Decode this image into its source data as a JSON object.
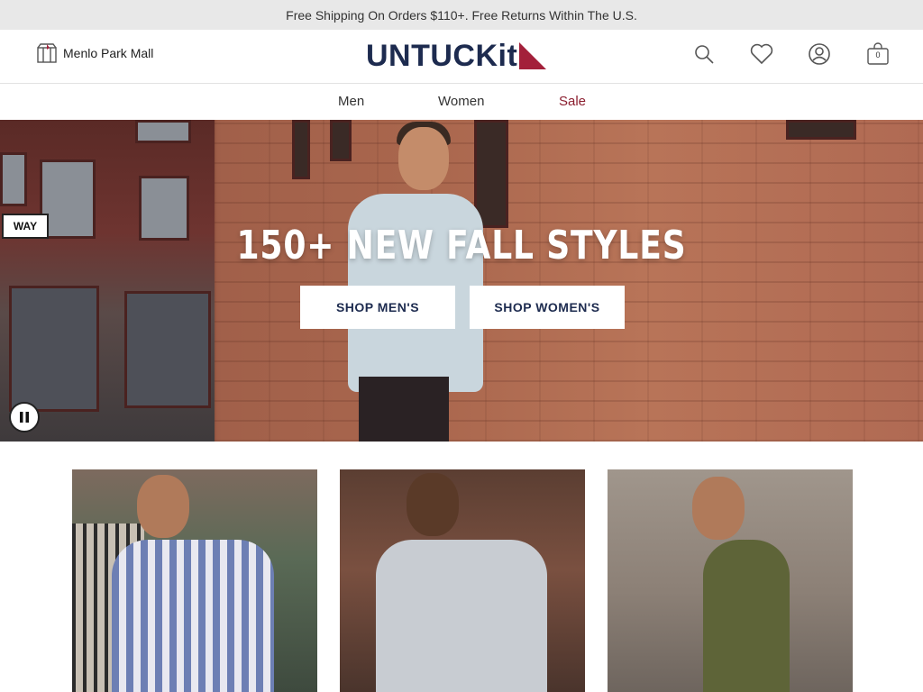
{
  "promo": {
    "text": "Free Shipping On Orders $110+. Free Returns Within The U.S."
  },
  "header": {
    "store_name": "Menlo Park Mall",
    "logo_text": "UNTUCKit",
    "icons": [
      "search-icon",
      "heart-icon",
      "account-icon",
      "bag-icon"
    ],
    "bag_count": "0"
  },
  "nav": {
    "items": [
      {
        "label": "Men"
      },
      {
        "label": "Women"
      },
      {
        "label": "Sale"
      }
    ],
    "sale_color": "#8b1e2f"
  },
  "hero": {
    "title": "150+ NEW FALL STYLES",
    "shop_men": "SHOP MEN'S",
    "shop_women": "SHOP WOMEN'S",
    "street_sign": "WAY",
    "pause_icon": "pause-icon"
  },
  "colors": {
    "brand_navy": "#1d2b4f",
    "brand_red": "#a3203a",
    "promo_bg": "#e8e8e8"
  }
}
